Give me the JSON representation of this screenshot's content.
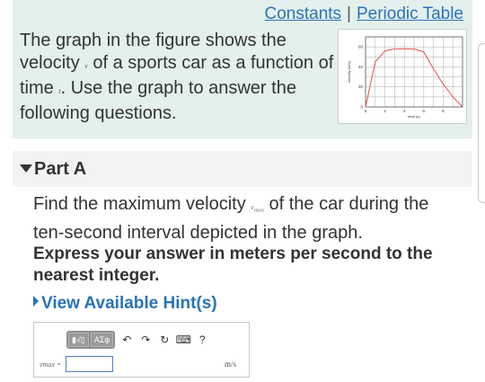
{
  "header": {
    "constants_link": "Constants",
    "separator": "|",
    "periodic_table_link": "Periodic Table"
  },
  "problem": {
    "text_1": "The graph in the figure shows the velocity ",
    "var_v": "v",
    "text_2": " of a sports car as a function of time ",
    "var_t": "t",
    "text_3": ". Use the graph to answer the following questions."
  },
  "chart_data": {
    "type": "line",
    "xlabel": "time (s)",
    "ylabel": "velocity (m/s)",
    "x_ticks": [
      "0",
      "2",
      "4",
      "6",
      "8"
    ],
    "y_ticks": [
      "0",
      "20",
      "40",
      "60"
    ],
    "xlim": [
      0,
      10
    ],
    "ylim": [
      0,
      70
    ],
    "grid": true,
    "series": [
      {
        "x": [
          0,
          1,
          2,
          3,
          4,
          5,
          6,
          7,
          8,
          9,
          10
        ],
        "y": [
          0,
          45,
          56,
          58,
          58,
          58,
          55,
          38,
          23,
          10,
          0
        ],
        "color": "#d9534f"
      }
    ]
  },
  "part": {
    "title": "Part A"
  },
  "question": {
    "text_1": "Find the maximum velocity ",
    "var": "v",
    "sub": "max",
    "text_2": " of the car during the ten-second interval depicted in the graph."
  },
  "instruction": "Express your answer in meters per second to the nearest integer.",
  "hints_label": "View Available Hint(s)",
  "answer": {
    "toolbar": {
      "template_btn": "▮√▯",
      "symbols_btn": "ΑΣφ",
      "undo_icon": "↶",
      "redo_icon": "↷",
      "reset_icon": "↻",
      "keyboard_icon": "⌨",
      "help_icon": "?"
    },
    "label": "vmax =",
    "value": "",
    "unit": "m/s"
  },
  "colors": {
    "intro_bg": "#e4f0ee",
    "link": "#2a73b8",
    "curve": "#d9534f"
  }
}
